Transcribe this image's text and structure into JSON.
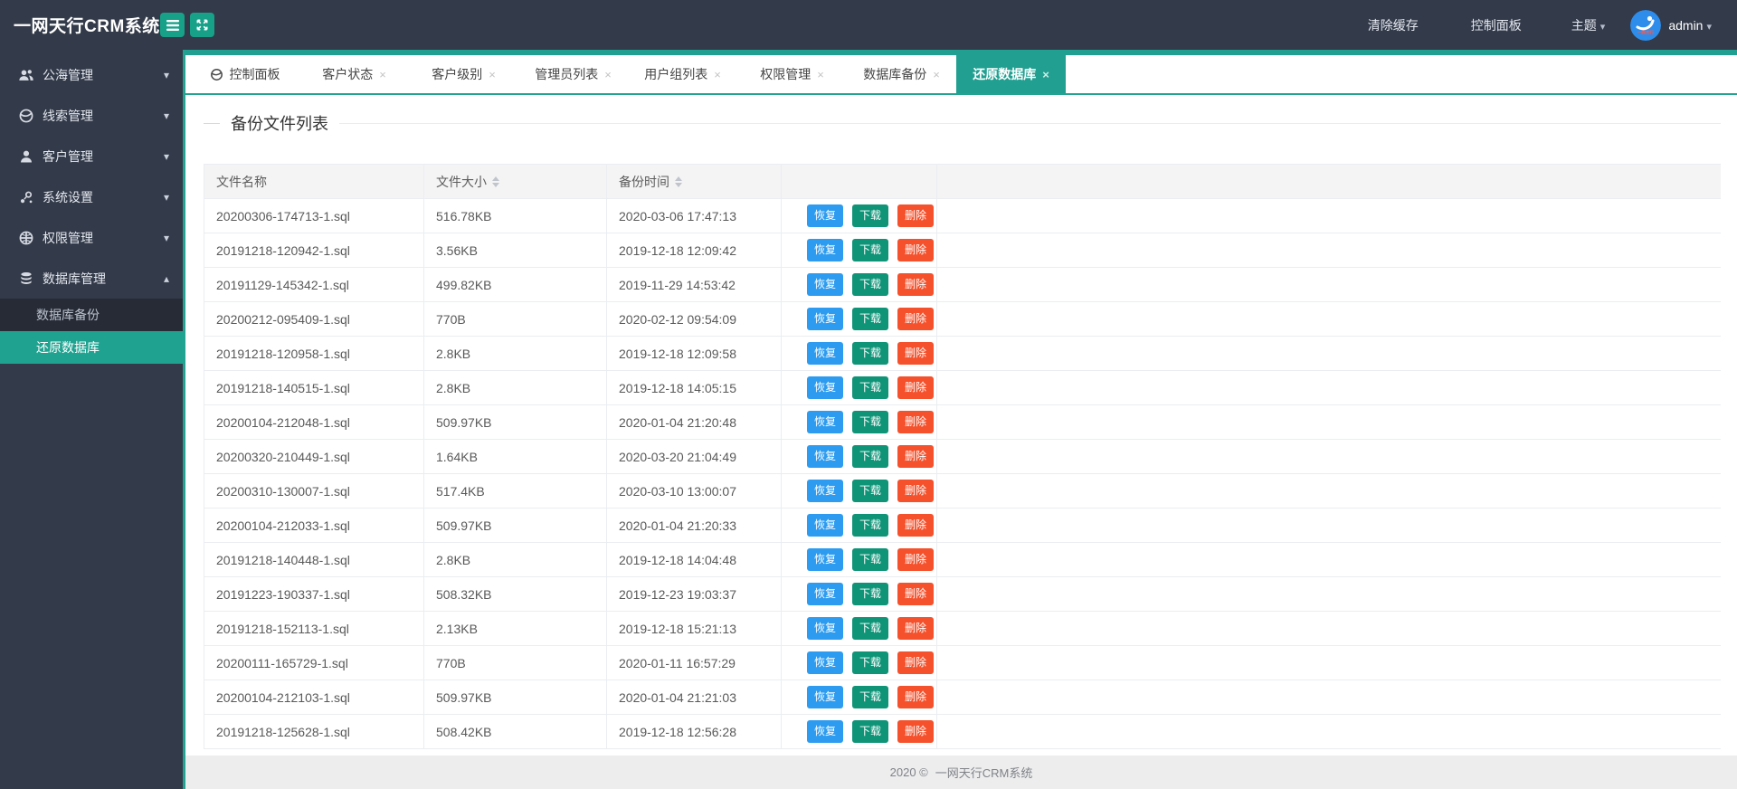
{
  "colors": {
    "accent_teal": "#21a092",
    "header_bg": "#333a49",
    "toggle_button_bg": "#17a189",
    "submenu_bg": "#262b36",
    "active_submenu_bg": "#1fa390",
    "btn_restore": "#2d9cf0",
    "btn_download": "#0f9478",
    "btn_delete": "#f4512c",
    "avatar_bg": "#2e8deb"
  },
  "header": {
    "logo": "一网天行CRM系统",
    "toggle_buttons": [
      {
        "icon": "hamburger-icon"
      },
      {
        "icon": "expand-icon"
      }
    ],
    "cache_label": "清除缓存",
    "panel_label": "控制面板",
    "theme_label": "主题",
    "username": "admin"
  },
  "sidebar": {
    "items": [
      {
        "label": "公海管理",
        "icon": "users-icon",
        "expanded": false
      },
      {
        "label": "线索管理",
        "icon": "globe-icon",
        "expanded": false
      },
      {
        "label": "客户管理",
        "icon": "user-icon",
        "expanded": false
      },
      {
        "label": "系统设置",
        "icon": "settings-icon",
        "expanded": false
      },
      {
        "label": "权限管理",
        "icon": "globe-grid-icon",
        "expanded": false
      },
      {
        "label": "数据库管理",
        "icon": "database-icon",
        "expanded": true,
        "children": [
          {
            "label": "数据库备份",
            "active": false
          },
          {
            "label": "还原数据库",
            "active": true
          }
        ]
      }
    ]
  },
  "tabs": [
    {
      "label": "控制面板",
      "icon": "dashboard-icon",
      "closable": false,
      "active": false
    },
    {
      "label": "客户状态",
      "closable": true,
      "active": false
    },
    {
      "label": "客户级别",
      "closable": true,
      "active": false
    },
    {
      "label": "管理员列表",
      "closable": true,
      "active": false
    },
    {
      "label": "用户组列表",
      "closable": true,
      "active": false
    },
    {
      "label": "权限管理",
      "closable": true,
      "active": false
    },
    {
      "label": "数据库备份",
      "closable": true,
      "active": false
    },
    {
      "label": "还原数据库",
      "closable": true,
      "active": true
    }
  ],
  "main": {
    "heading": "备份文件列表",
    "table": {
      "columns": [
        {
          "label": "文件名称",
          "sortable": false
        },
        {
          "label": "文件大小",
          "sortable": true
        },
        {
          "label": "备份时间",
          "sortable": true
        },
        {
          "label": "",
          "sortable": false
        }
      ],
      "action_buttons": [
        {
          "label": "恢复",
          "kind": "restore"
        },
        {
          "label": "下载",
          "kind": "download"
        },
        {
          "label": "删除",
          "kind": "delete"
        }
      ],
      "rows": [
        {
          "name": "20200306-174713-1.sql",
          "size": "516.78KB",
          "time": "2020-03-06 17:47:13"
        },
        {
          "name": "20191218-120942-1.sql",
          "size": "3.56KB",
          "time": "2019-12-18 12:09:42"
        },
        {
          "name": "20191129-145342-1.sql",
          "size": "499.82KB",
          "time": "2019-11-29 14:53:42"
        },
        {
          "name": "20200212-095409-1.sql",
          "size": "770B",
          "time": "2020-02-12 09:54:09"
        },
        {
          "name": "20191218-120958-1.sql",
          "size": "2.8KB",
          "time": "2019-12-18 12:09:58"
        },
        {
          "name": "20191218-140515-1.sql",
          "size": "2.8KB",
          "time": "2019-12-18 14:05:15"
        },
        {
          "name": "20200104-212048-1.sql",
          "size": "509.97KB",
          "time": "2020-01-04 21:20:48"
        },
        {
          "name": "20200320-210449-1.sql",
          "size": "1.64KB",
          "time": "2020-03-20 21:04:49"
        },
        {
          "name": "20200310-130007-1.sql",
          "size": "517.4KB",
          "time": "2020-03-10 13:00:07"
        },
        {
          "name": "20200104-212033-1.sql",
          "size": "509.97KB",
          "time": "2020-01-04 21:20:33"
        },
        {
          "name": "20191218-140448-1.sql",
          "size": "2.8KB",
          "time": "2019-12-18 14:04:48"
        },
        {
          "name": "20191223-190337-1.sql",
          "size": "508.32KB",
          "time": "2019-12-23 19:03:37"
        },
        {
          "name": "20191218-152113-1.sql",
          "size": "2.13KB",
          "time": "2019-12-18 15:21:13"
        },
        {
          "name": "20200111-165729-1.sql",
          "size": "770B",
          "time": "2020-01-11 16:57:29"
        },
        {
          "name": "20200104-212103-1.sql",
          "size": "509.97KB",
          "time": "2020-01-04 21:21:03"
        },
        {
          "name": "20191218-125628-1.sql",
          "size": "508.42KB",
          "time": "2019-12-18 12:56:28"
        }
      ]
    }
  },
  "footer": {
    "year": "2020 ©",
    "name": "一网天行CRM系统"
  }
}
